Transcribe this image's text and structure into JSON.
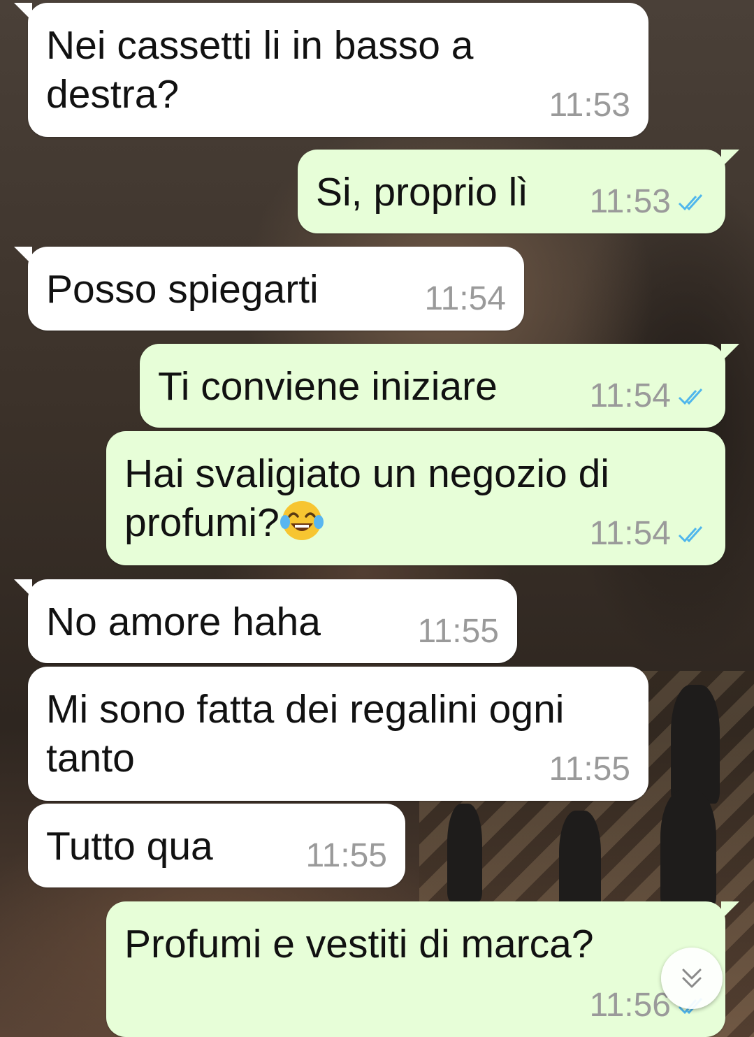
{
  "colors": {
    "incoming_bubble": "#ffffff",
    "outgoing_bubble": "#e7fed8",
    "timestamp": "#9a9a9a",
    "read_ticks": "#4fb6ec"
  },
  "messages": [
    {
      "direction": "incoming",
      "text": "Nei cassetti li in basso a\ndestra?",
      "time": "11:53"
    },
    {
      "direction": "outgoing",
      "text": "Si, proprio lì",
      "time": "11:53",
      "status": "read"
    },
    {
      "direction": "incoming",
      "text": "Posso spiegarti",
      "time": "11:54"
    },
    {
      "direction": "outgoing",
      "text": "Ti conviene iniziare",
      "time": "11:54",
      "status": "read"
    },
    {
      "direction": "outgoing",
      "text": "Hai svaligiato un negozio di\nprofumi?",
      "emoji": "face-with-tears-of-joy",
      "time": "11:54",
      "status": "read"
    },
    {
      "direction": "incoming",
      "text": "No amore haha",
      "time": "11:55"
    },
    {
      "direction": "incoming",
      "text": "Mi sono fatta dei regalini ogni\ntanto",
      "time": "11:55"
    },
    {
      "direction": "incoming",
      "text": "Tutto qua",
      "time": "11:55"
    },
    {
      "direction": "outgoing",
      "text": "Profumi e vestiti di marca?",
      "time": "11:56",
      "status": "read"
    }
  ],
  "scroll_button": {
    "icon": "double-chevron-down-icon"
  }
}
